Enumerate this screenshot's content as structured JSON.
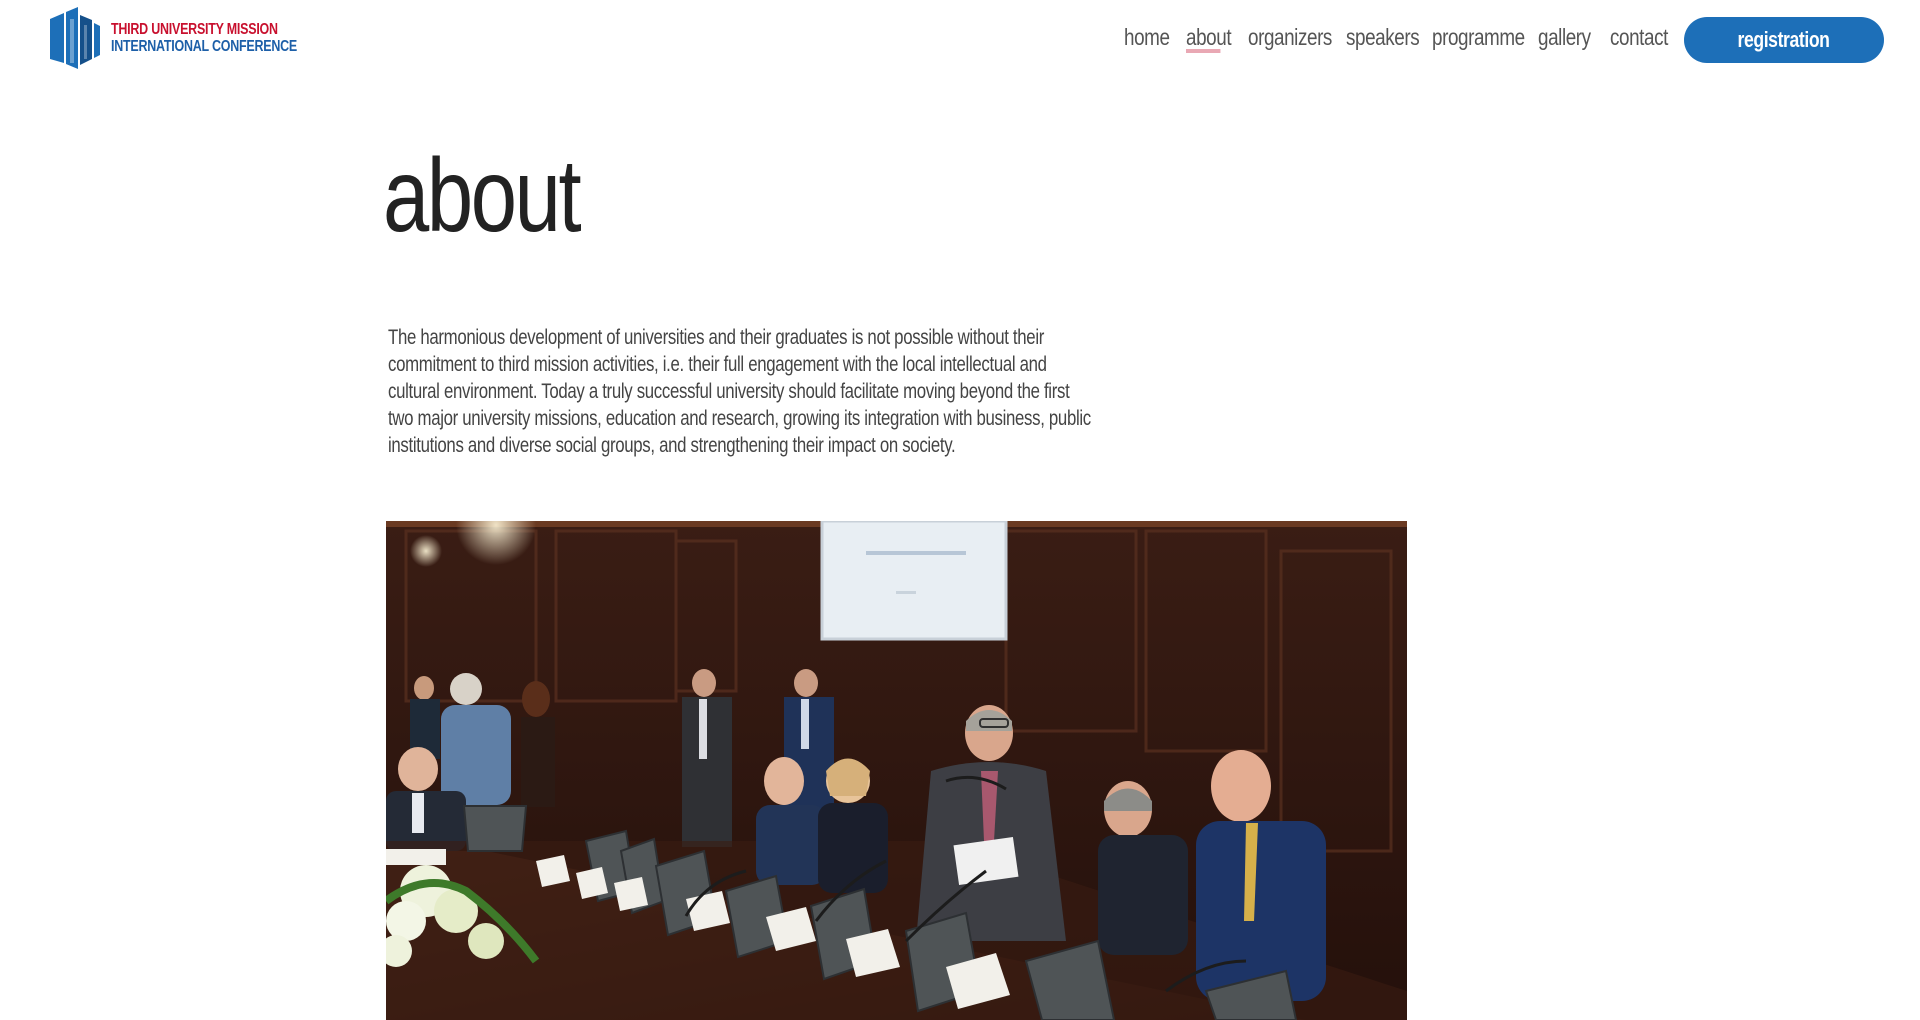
{
  "logo": {
    "line1": "THIRD  UNIVERSITY MISSION",
    "line2": "INTERNATIONAL CONFERENCE",
    "icon": "building-columns-logo",
    "colors": {
      "red": "#c8102e",
      "blue": "#1d5fa8"
    }
  },
  "nav": {
    "items": [
      {
        "label": "home"
      },
      {
        "label": "about",
        "active": true
      },
      {
        "label": "organizers"
      },
      {
        "label": "speakers"
      },
      {
        "label": "programme"
      },
      {
        "label": "gallery"
      },
      {
        "label": "contact"
      }
    ]
  },
  "register_button": {
    "label": "registration",
    "color": "#1d6fb8"
  },
  "main": {
    "title": "about",
    "intro": "The harmonious development of universities and their graduates is not possible without their commitment to third mission activities, i.e. their full engagement with the local intellectual and cultural environment. Today a truly successful university should facilitate moving beyond the first two major university missions, education and research, growing its integration with business, public institutions and diverse social groups, and strengthening their impact on society."
  },
  "photo": {
    "subject": "conference-panel-photo"
  }
}
